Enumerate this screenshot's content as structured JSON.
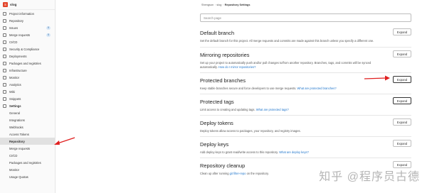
{
  "project": {
    "avatar_letter": "S",
    "name": "slog"
  },
  "sidebar": {
    "items": [
      {
        "label": "Project information",
        "icon": "info-icon"
      },
      {
        "label": "Repository",
        "icon": "book-icon"
      },
      {
        "label": "Issues",
        "icon": "issues-icon",
        "count": "0"
      },
      {
        "label": "Merge requests",
        "icon": "merge-request-icon",
        "count": "0"
      },
      {
        "label": "CI/CD",
        "icon": "rocket-icon"
      },
      {
        "label": "Security & Compliance",
        "icon": "shield-icon"
      },
      {
        "label": "Deployments",
        "icon": "deployments-icon"
      },
      {
        "label": "Packages and registries",
        "icon": "package-icon"
      },
      {
        "label": "Infrastructure",
        "icon": "cloud-icon"
      },
      {
        "label": "Monitor",
        "icon": "monitor-icon"
      },
      {
        "label": "Analytics",
        "icon": "chart-icon"
      },
      {
        "label": "Wiki",
        "icon": "book-icon"
      },
      {
        "label": "Snippets",
        "icon": "snippet-icon"
      },
      {
        "label": "Settings",
        "icon": "gear-icon"
      }
    ],
    "settings_sub": [
      "General",
      "Integrations",
      "Webhooks",
      "Access Tokens",
      "Repository",
      "Merge requests",
      "CI/CD",
      "Packages and registries",
      "Monitor",
      "Usage Quotas"
    ]
  },
  "breadcrumb": {
    "user": "Shengson",
    "project": "slog",
    "current": "Repository Settings"
  },
  "search": {
    "placeholder": "Search page"
  },
  "expand_label": "Expand",
  "sections": [
    {
      "title": "Default branch",
      "desc": "Set the default branch for this project. All merge requests and commits are made against this branch unless you specify a different one."
    },
    {
      "title": "Mirroring repositories",
      "desc": "Set up your project to automatically push and/or pull changes to/from another repository. Branches, tags, and commits will be synced automatically.",
      "link": "How do I mirror repositories?"
    },
    {
      "title": "Protected branches",
      "desc": "Keep stable branches secure and force developers to use merge requests.",
      "link": "What are protected branches?"
    },
    {
      "title": "Protected tags",
      "desc": "Limit access to creating and updating tags.",
      "link": "What are protected tags?"
    },
    {
      "title": "Deploy tokens",
      "desc": "Deploy tokens allow access to packages, your repository, and registry images."
    },
    {
      "title": "Deploy keys",
      "desc": "Add deploy keys to grant read/write access to this repository.",
      "link": "What are deploy keys?"
    },
    {
      "title": "Repository cleanup",
      "desc": "Clean up after running",
      "link": "git filter-repo",
      "desc_after": "on the repository."
    }
  ],
  "watermark": "知乎 @程序员古德",
  "colors": {
    "accent": "#1f75cb",
    "annotation_arrow": "#e02020",
    "project_avatar": "#e24329"
  }
}
